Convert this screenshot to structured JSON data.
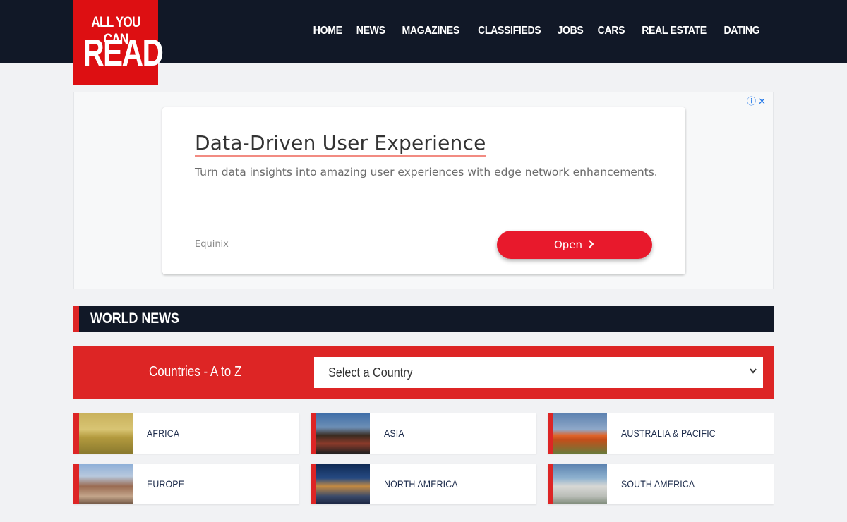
{
  "header": {
    "logo_top": "ALL YOU CAN",
    "logo_big": "READ",
    "nav": [
      "HOME",
      "NEWS",
      "MAGAZINES",
      "CLASSIFIEDS",
      "JOBS",
      "CARS",
      "REAL ESTATE",
      "DATING"
    ]
  },
  "ad": {
    "info_icon": "info-icon",
    "close_icon": "close-icon",
    "title": "Data-Driven User Experience",
    "description": "Turn data insights into amazing user experiences with edge network enhancements.",
    "brand": "Equinix",
    "cta_label": "Open",
    "cta_color": "#e8192c"
  },
  "section": {
    "title": "WORLD NEWS"
  },
  "countries": {
    "label": "Countries - A to Z",
    "select_value": "Select a Country"
  },
  "regions": [
    {
      "name": "AFRICA",
      "thumb": "africa-photo"
    },
    {
      "name": "ASIA",
      "thumb": "asia-photo"
    },
    {
      "name": "AUSTRALIA & PACIFIC",
      "thumb": "australia-photo"
    },
    {
      "name": "EUROPE",
      "thumb": "europe-photo"
    },
    {
      "name": "NORTH AMERICA",
      "thumb": "north-america-photo"
    },
    {
      "name": "SOUTH AMERICA",
      "thumb": "south-america-photo"
    }
  ],
  "colors": {
    "header_bg": "#111827",
    "accent_red": "#dd2525",
    "page_bg": "#f1f2f4"
  }
}
